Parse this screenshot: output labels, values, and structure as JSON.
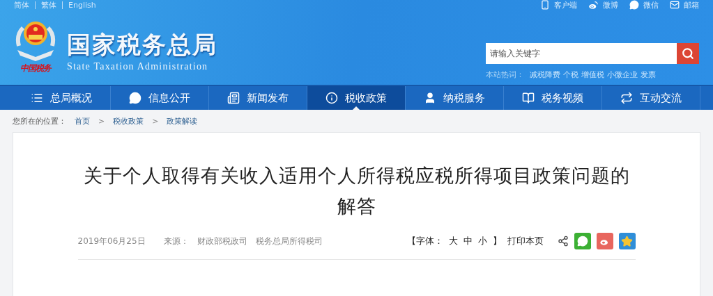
{
  "language_links": [
    {
      "label": "简体"
    },
    {
      "label": "繁体"
    },
    {
      "label": "English"
    }
  ],
  "quick_links": [
    {
      "kind": "phone",
      "label": "客户端"
    },
    {
      "kind": "weibo",
      "label": "微博"
    },
    {
      "kind": "wechat",
      "label": "微信"
    },
    {
      "kind": "mail",
      "label": "邮箱"
    }
  ],
  "logo": {
    "script": "中国税务",
    "title": "国家税务总局",
    "subtitle": "State Taxation Administration"
  },
  "search": {
    "placeholder": "请输入关键字"
  },
  "hot_words": {
    "label": "本站热词：",
    "items": [
      "减税降费",
      "个税",
      "增值税",
      "小微企业",
      "发票"
    ]
  },
  "nav": [
    {
      "kind": "list",
      "label": "总局概况",
      "selected": false
    },
    {
      "kind": "chat",
      "label": "信息公开",
      "selected": false
    },
    {
      "kind": "news",
      "label": "新闻发布",
      "selected": false
    },
    {
      "kind": "info",
      "label": "税收政策",
      "selected": true
    },
    {
      "kind": "user",
      "label": "纳税服务",
      "selected": false
    },
    {
      "kind": "book",
      "label": "税务视频",
      "selected": false
    },
    {
      "kind": "swap",
      "label": "互动交流",
      "selected": false
    }
  ],
  "breadcrumb": {
    "label": "您所在的位置：",
    "items": [
      "首页",
      "税收政策",
      "政策解读"
    ],
    "separator": ">"
  },
  "article": {
    "title": "关于个人取得有关收入适用个人所得税应税所得项目政策问题的解答",
    "date": "2019年06月25日",
    "source_label": "来源：",
    "sources": [
      "财政部税政司",
      "税务总局所得税司"
    ],
    "font_size": {
      "open": "【字体：",
      "options": [
        "大",
        "中",
        "小"
      ],
      "close": "】"
    },
    "print": "打印本页",
    "share": [
      {
        "kind": "share"
      },
      {
        "kind": "wechat"
      },
      {
        "kind": "weibo"
      },
      {
        "kind": "qzone"
      }
    ]
  }
}
